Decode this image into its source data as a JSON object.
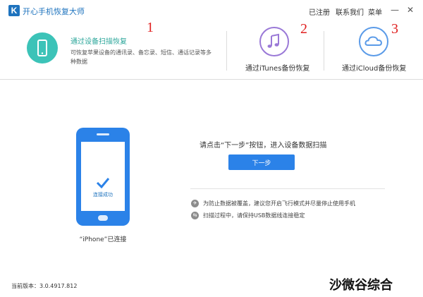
{
  "titlebar": {
    "logo_letter": "K",
    "app_title": "开心手机恢复大师",
    "registered": "已注册",
    "contact": "联系我们",
    "menu": "菜单",
    "minimize": "—",
    "close": "✕"
  },
  "options": [
    {
      "title": "通过设备扫描恢复",
      "desc": "可恢复苹果设备的通讯录、备忘录、短信、通话记录等多种数据",
      "annotation": "1"
    },
    {
      "title": "通过iTunes备份恢复",
      "annotation": "2"
    },
    {
      "title": "通过iCloud备份恢复",
      "annotation": "3"
    }
  ],
  "device": {
    "connected": "连接成功",
    "label": "“iPhone”已连接"
  },
  "main": {
    "prompt": "请点击“下一步”按钮，进入设备数据扫描",
    "next_button": "下一步",
    "tips": [
      "为防止数据被覆盖，建议您开启飞行模式并尽量停止使用手机",
      "扫描过程中，请保持USB数据线连接稳定"
    ]
  },
  "footer": {
    "version": "当前版本：3.0.4917.812",
    "watermark": "沙微谷综合"
  },
  "colors": {
    "brand_blue": "#2b82e8",
    "teal": "#3cc3b8",
    "purple": "#9a79d7",
    "annotation_red": "#e02020"
  }
}
